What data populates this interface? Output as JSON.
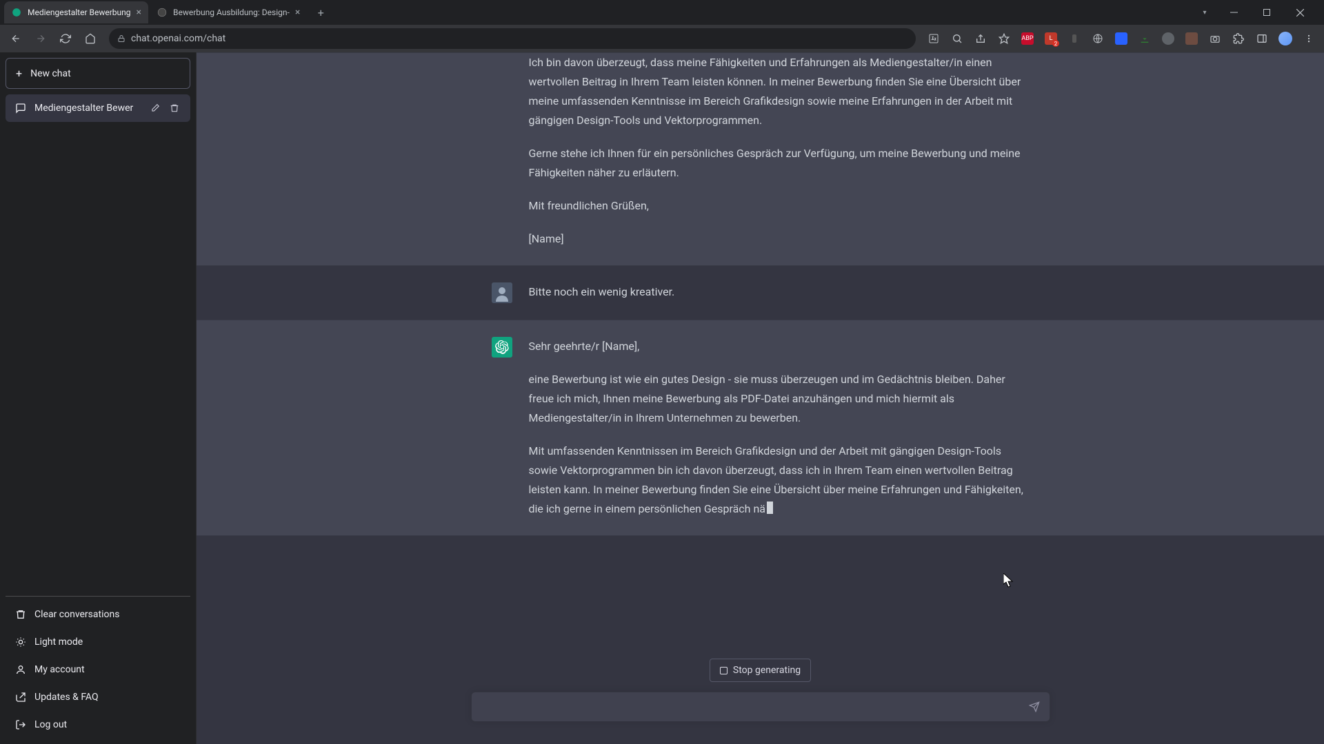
{
  "browser": {
    "tabs": [
      {
        "title": "Mediengestalter Bewerbung",
        "active": true
      },
      {
        "title": "Bewerbung Ausbildung: Design-",
        "active": false
      }
    ],
    "url": "chat.openai.com/chat"
  },
  "sidebar": {
    "new_chat_label": "New chat",
    "conversations": [
      {
        "title": "Mediengestalter Bewer",
        "active": true
      }
    ],
    "bottom_items": [
      {
        "icon": "trash-icon",
        "label": "Clear conversations"
      },
      {
        "icon": "sun-icon",
        "label": "Light mode"
      },
      {
        "icon": "user-icon",
        "label": "My account"
      },
      {
        "icon": "link-icon",
        "label": "Updates & FAQ"
      },
      {
        "icon": "logout-icon",
        "label": "Log out"
      }
    ]
  },
  "chat": {
    "messages": [
      {
        "role": "assistant",
        "paragraphs": [
          "Ich bin davon überzeugt, dass meine Fähigkeiten und Erfahrungen als Mediengestalter/in einen wertvollen Beitrag in Ihrem Team leisten können. In meiner Bewerbung finden Sie eine Übersicht über meine umfassenden Kenntnisse im Bereich Grafikdesign sowie meine Erfahrungen in der Arbeit mit gängigen Design-Tools und Vektorprogrammen.",
          "Gerne stehe ich Ihnen für ein persönliches Gespräch zur Verfügung, um meine Bewerbung und meine Fähigkeiten näher zu erläutern.",
          "Mit freundlichen Grüßen,",
          "[Name]"
        ]
      },
      {
        "role": "user",
        "paragraphs": [
          "Bitte noch ein wenig kreativer."
        ]
      },
      {
        "role": "assistant",
        "paragraphs": [
          "Sehr geehrte/r [Name],",
          "eine Bewerbung ist wie ein gutes Design - sie muss überzeugen und im Gedächtnis bleiben. Daher freue ich mich, Ihnen meine Bewerbung als PDF-Datei anzuhängen und mich hiermit als Mediengestalter/in in Ihrem Unternehmen zu bewerben.",
          "Mit umfassenden Kenntnissen im Bereich Grafikdesign und der Arbeit mit gängigen Design-Tools sowie Vektorprogrammen bin ich davon überzeugt, dass ich in Ihrem Team einen wertvollen Beitrag leisten kann. In meiner Bewerbung finden Sie eine Übersicht über meine Erfahrungen und Fähigkeiten, die ich gerne in einem persönlichen Gespräch nä"
        ],
        "streaming": true
      }
    ],
    "stop_label": "Stop generating",
    "input_placeholder": ""
  }
}
